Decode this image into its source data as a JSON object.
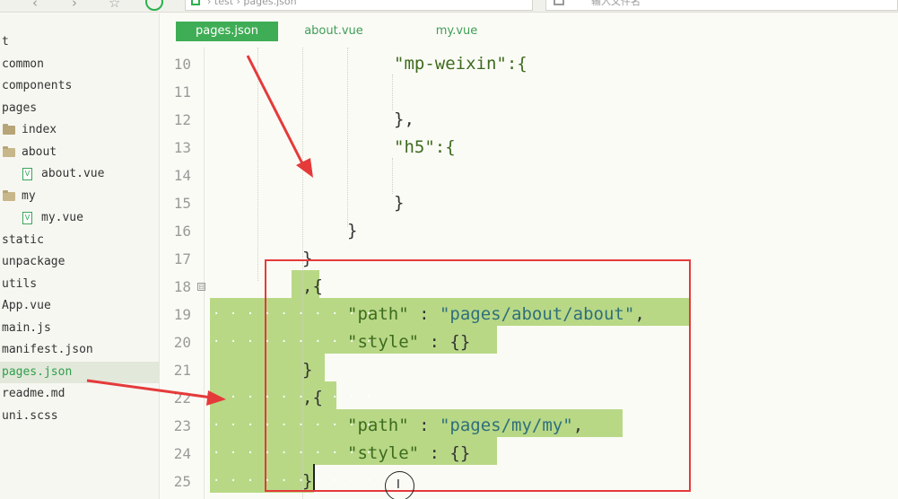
{
  "topbar": {
    "back_icon": "‹",
    "forward_icon": "›",
    "star_icon": "☆",
    "breadcrumb_text": "› test › pages.json",
    "search_placeholder": "输入文件名"
  },
  "sidebar": {
    "items": [
      {
        "label": "t",
        "type": "project"
      },
      {
        "label": "common",
        "type": "folder"
      },
      {
        "label": "components",
        "type": "folder"
      },
      {
        "label": "pages",
        "type": "folder"
      },
      {
        "label": "index",
        "type": "folder"
      },
      {
        "label": "about",
        "type": "folder-open"
      },
      {
        "label": "about.vue",
        "type": "vue-file"
      },
      {
        "label": "my",
        "type": "folder-open"
      },
      {
        "label": "my.vue",
        "type": "vue-file"
      },
      {
        "label": "static",
        "type": "folder"
      },
      {
        "label": "unpackage",
        "type": "folder"
      },
      {
        "label": "utils",
        "type": "folder"
      },
      {
        "label": "App.vue",
        "type": "file"
      },
      {
        "label": "main.js",
        "type": "file"
      },
      {
        "label": "manifest.json",
        "type": "file"
      },
      {
        "label": "pages.json",
        "type": "file",
        "active": true
      },
      {
        "label": "readme.md",
        "type": "file"
      },
      {
        "label": "uni.scss",
        "type": "file"
      }
    ]
  },
  "tabs": [
    {
      "label": "pages.json",
      "active": true
    },
    {
      "label": "about.vue",
      "active": false
    },
    {
      "label": "my.vue",
      "active": false
    }
  ],
  "editor": {
    "lines": [
      {
        "number": "10",
        "text": "\"mp-weixin\":{"
      },
      {
        "number": "11",
        "text": ""
      },
      {
        "number": "12",
        "text": "},"
      },
      {
        "number": "13",
        "text": "\"h5\":{"
      },
      {
        "number": "14",
        "text": ""
      },
      {
        "number": "15",
        "text": "}"
      },
      {
        "number": "16",
        "text": "}"
      },
      {
        "number": "17",
        "text": "}"
      },
      {
        "number": "18",
        "text": ",{"
      },
      {
        "number": "19",
        "key": "\"path\"",
        "sep": " : ",
        "value": "\"pages/about/about\"",
        "tail": ","
      },
      {
        "number": "20",
        "key": "\"style\"",
        "sep": " : ",
        "value": "{}"
      },
      {
        "number": "21",
        "text": "}"
      },
      {
        "number": "22",
        "text": ",{"
      },
      {
        "number": "23",
        "key": "\"path\"",
        "sep": " : ",
        "value": "\"pages/my/my\"",
        "tail": ","
      },
      {
        "number": "24",
        "key": "\"style\"",
        "sep": " : ",
        "value": "{}"
      },
      {
        "number": "25",
        "text": "}"
      }
    ],
    "fold_marker": "⊟",
    "whitespace_dots": "· · · · · · · · · ·",
    "highlight_color": "#b8d886"
  },
  "colors": {
    "accent_green": "#3fad55",
    "annotation_red": "#e53a3a"
  }
}
